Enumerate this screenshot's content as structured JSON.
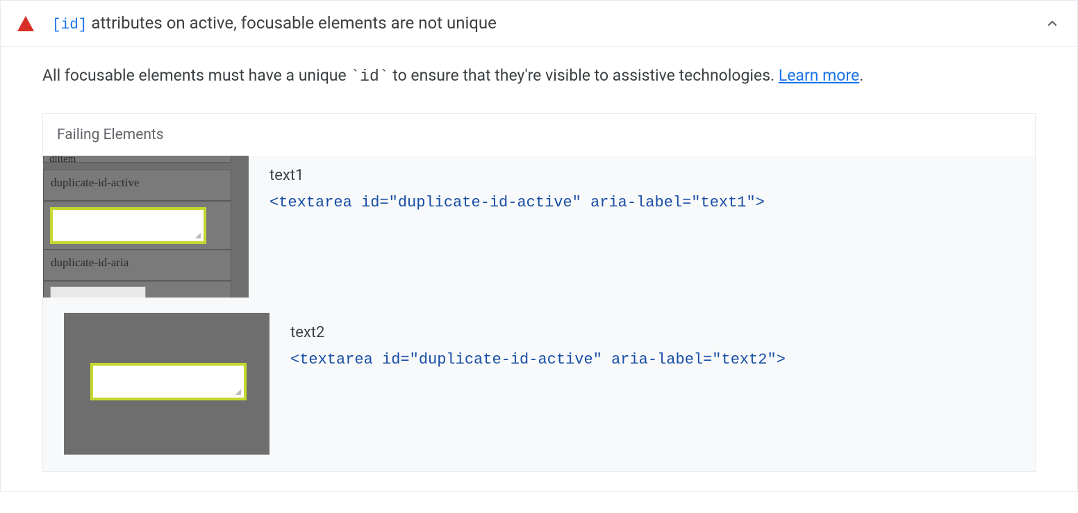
{
  "audit": {
    "title_code": "[id]",
    "title_rest": " attributes on active, focusable elements are not unique",
    "description_prefix": "All focusable elements must have a unique ",
    "description_code": "`id`",
    "description_suffix": " to ensure that they're visible to assistive technologies. ",
    "learn_more": "Learn more",
    "description_period": "."
  },
  "failing": {
    "heading": "Failing Elements",
    "items": [
      {
        "label": "text1",
        "code": "<textarea id=\"duplicate-id-active\" aria-label=\"text1\">",
        "thumb_text_top": "dlitem",
        "thumb_text_a": "duplicate-id-active",
        "thumb_text_c": "duplicate-id-aria"
      },
      {
        "label": "text2",
        "code": "<textarea id=\"duplicate-id-active\" aria-label=\"text2\">"
      }
    ]
  }
}
